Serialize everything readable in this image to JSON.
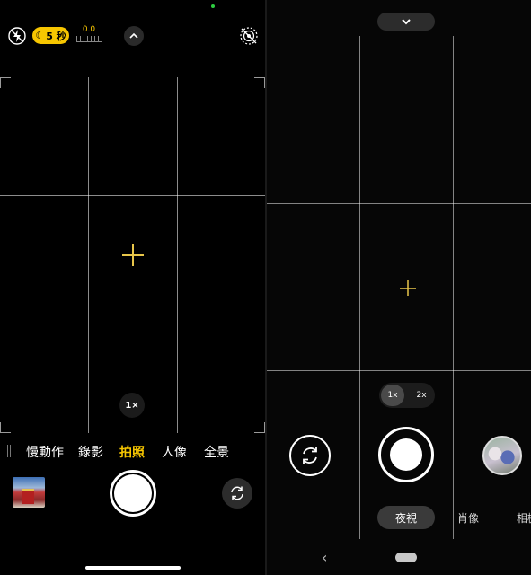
{
  "ios": {
    "night_mode_label": "5 秒",
    "exposure_value": "0.0",
    "zoom_label": "1×",
    "modes": [
      "慢動作",
      "錄影",
      "拍照",
      "人像",
      "全景"
    ],
    "active_mode": "拍照",
    "icons": {
      "flash": "flash-off-icon",
      "night": "moon-icon",
      "expand": "chevron-up-icon",
      "live": "live-photo-off-icon",
      "flip": "camera-flip-icon"
    },
    "accent_color": "#f7c600"
  },
  "android": {
    "zoom_options": [
      "1x",
      "2x"
    ],
    "selected_zoom": "1x",
    "modes": [
      "夜視",
      "肖像",
      "相機"
    ],
    "active_mode": "夜視",
    "icons": {
      "collapse": "chevron-down-icon",
      "flip": "camera-switch-icon",
      "back": "back-icon",
      "home": "home-pill-icon"
    }
  }
}
